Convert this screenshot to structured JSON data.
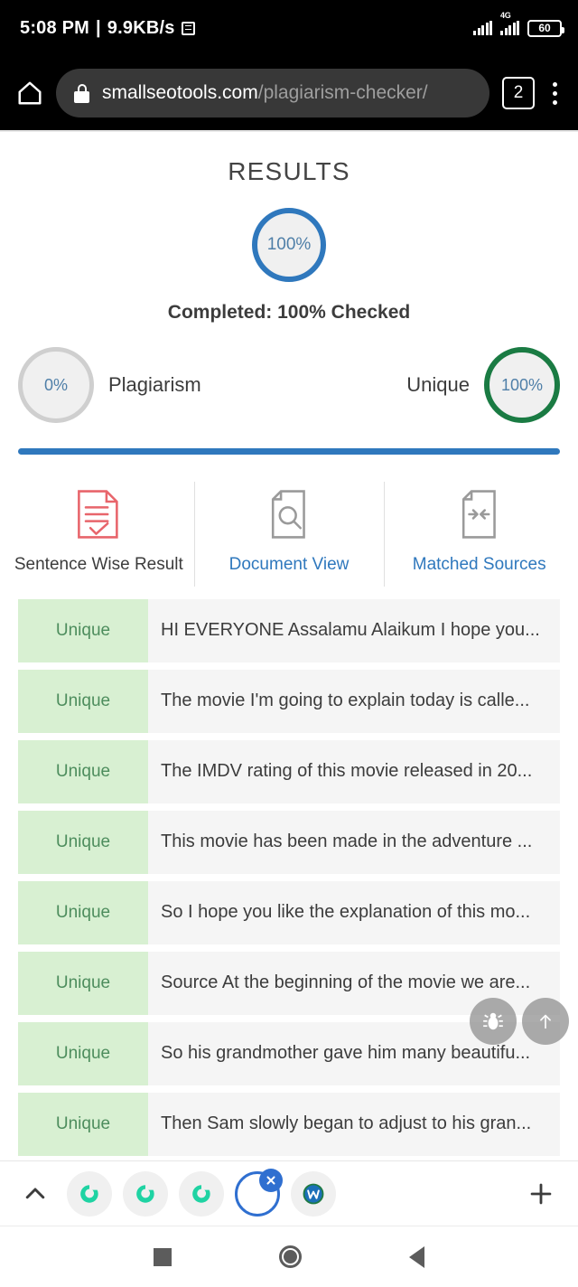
{
  "status_bar": {
    "time": "5:08 PM",
    "separator": "|",
    "network_speed": "9.9KB/s",
    "sms_icon": "sms-icon",
    "signal_label": "4G",
    "battery_level": "60"
  },
  "browser": {
    "home_icon": "home-icon",
    "lock_icon": "lock-icon",
    "url_domain": "smallseotools.com",
    "url_path": "/plagiarism-checker/",
    "tab_count": "2",
    "menu_icon": "kebab-menu-icon"
  },
  "results": {
    "title": "RESULTS",
    "main_circle_value": "100%",
    "completed_text": "Completed: 100% Checked",
    "plagiarism": {
      "value": "0%",
      "label": "Plagiarism"
    },
    "unique": {
      "value": "100%",
      "label": "Unique"
    },
    "progress_percent": 100
  },
  "tabs": [
    {
      "label": "Sentence Wise Result",
      "icon": "document-check-icon",
      "active": true
    },
    {
      "label": "Document View",
      "icon": "document-search-icon",
      "active": false
    },
    {
      "label": "Matched Sources",
      "icon": "document-arrows-icon",
      "active": false
    }
  ],
  "sentences": [
    {
      "status": "Unique",
      "text": "HI EVERYONE Assalamu Alaikum I hope you..."
    },
    {
      "status": "Unique",
      "text": "The movie I'm going to explain today is calle..."
    },
    {
      "status": "Unique",
      "text": "The IMDV rating of this movie released in 20..."
    },
    {
      "status": "Unique",
      "text": "This movie has been made in the adventure ..."
    },
    {
      "status": "Unique",
      "text": "So I hope you like the explanation of this mo..."
    },
    {
      "status": "Unique",
      "text": "Source At the beginning of the movie we are..."
    },
    {
      "status": "Unique",
      "text": "So his grandmother gave him many beautifu..."
    },
    {
      "status": "Unique",
      "text": "Then Sam slowly began to adjust to his gran..."
    }
  ],
  "floating_buttons": [
    {
      "name": "bug-icon"
    },
    {
      "name": "scroll-to-top-icon"
    }
  ],
  "tab_strip": {
    "expand_icon": "chevron-up-icon",
    "new_tab_icon": "plus-icon",
    "tabs": [
      {
        "icon": "seotools-favicon",
        "active": false
      },
      {
        "icon": "seotools-favicon",
        "active": false
      },
      {
        "icon": "seotools-favicon",
        "active": false
      },
      {
        "icon": "blank-tab",
        "active": true,
        "close_icon": "close-icon"
      },
      {
        "icon": "wikipedia-favicon",
        "active": false
      }
    ]
  },
  "android_nav": {
    "recents": "recents-square-icon",
    "home": "home-circle-icon",
    "back": "back-triangle-icon"
  },
  "colors": {
    "accent_blue": "#2f78bd",
    "unique_green": "#1a7b43",
    "badge_green_bg": "#d8f0d2",
    "badge_green_text": "#4d8d5d",
    "doc_red": "#e8656b",
    "grey_ring": "#cfcfcf"
  }
}
